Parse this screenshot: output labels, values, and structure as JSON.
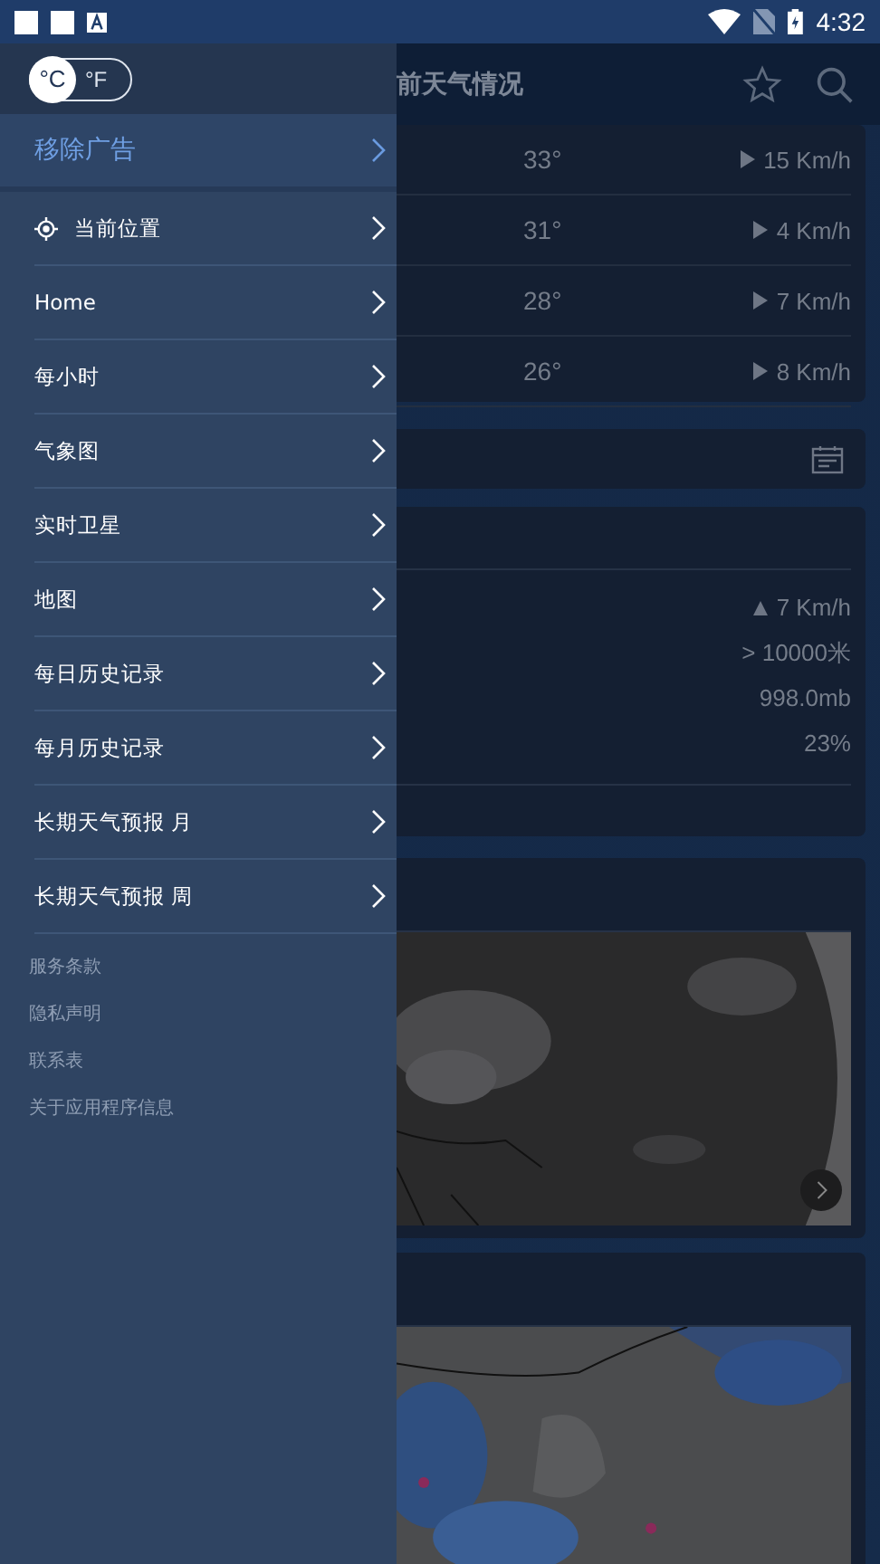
{
  "status_bar": {
    "time": "4:32"
  },
  "drawer": {
    "units": [
      {
        "label": "°C",
        "selected": true
      },
      {
        "label": "°F",
        "selected": false
      }
    ],
    "promo": {
      "label": "移除广告"
    },
    "items": [
      {
        "label": "当前位置",
        "kind": "location"
      },
      {
        "label": "Home",
        "kind": "plain"
      },
      {
        "label": "每小时",
        "kind": "plain"
      },
      {
        "label": "气象图",
        "kind": "plain"
      },
      {
        "label": "实时卫星",
        "kind": "plain"
      },
      {
        "label": "地图",
        "kind": "plain"
      },
      {
        "label": "每日历史记录",
        "kind": "plain"
      },
      {
        "label": "每月历史记录",
        "kind": "plain"
      },
      {
        "label": "长期天气预报 月",
        "kind": "plain"
      },
      {
        "label": "长期天气预报 周",
        "kind": "plain"
      }
    ],
    "links": [
      "服务条款",
      "隐私声明",
      "联系表",
      "关于应用程序信息"
    ]
  },
  "toolbar": {
    "title": "前天气情况"
  },
  "hourly": [
    {
      "temp": "33°",
      "wind": "15 Km/h"
    },
    {
      "temp": "31°",
      "wind": "4 Km/h"
    },
    {
      "temp": "28°",
      "wind": "7 Km/h"
    },
    {
      "temp": "26°",
      "wind": "8 Km/h"
    }
  ],
  "details": [
    {
      "value": "7 Km/h",
      "kind": "wind"
    },
    {
      "value": "> 10000米",
      "kind": "plain"
    },
    {
      "value": "998.0mb",
      "kind": "plain"
    },
    {
      "value": "23%",
      "kind": "plain"
    }
  ]
}
